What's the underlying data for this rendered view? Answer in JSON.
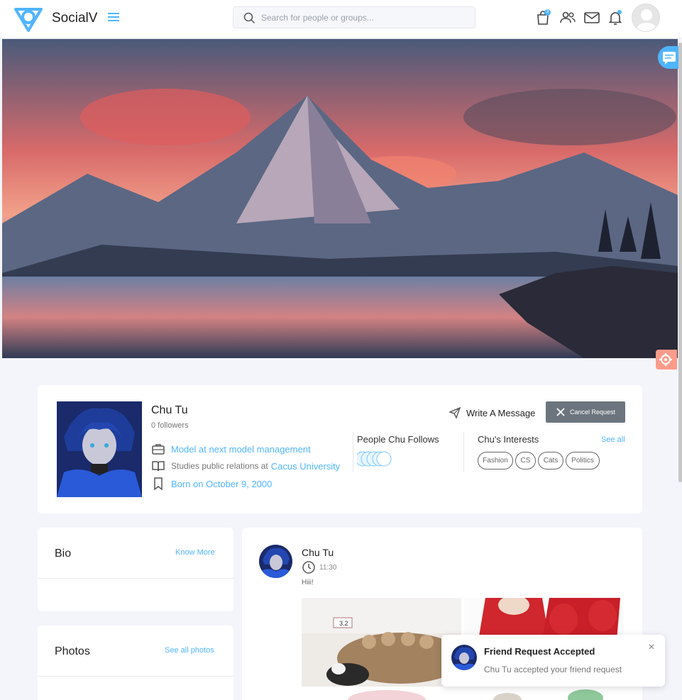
{
  "header": {
    "brand": "SocialV",
    "search_placeholder": "Search for people or groups...",
    "cart_badge": "3"
  },
  "profile": {
    "name": "Chu Tu",
    "followers": "0 followers",
    "job": "Model at next model management",
    "study_prefix": "Studies public relations at",
    "study_school": "Cacus University",
    "birthday": "Born on October 9, 2000",
    "write_message": "Write A Message",
    "cancel_request": "Cancel Request",
    "follows_title": "People Chu Follows",
    "interests_title": "Chu's Interests",
    "interests_see_all": "See all",
    "interests": [
      "Fashion",
      "CS",
      "Cats",
      "Politics"
    ]
  },
  "bio": {
    "title": "Bio",
    "link": "Know More"
  },
  "photos": {
    "title": "Photos",
    "link": "See all photos"
  },
  "post": {
    "author": "Chu Tu",
    "time": "11:30",
    "text": "Hiii!",
    "image1_label": "3.2"
  },
  "toast": {
    "title": "Friend Request Accepted",
    "message": "Chu Tu accepted your friend request",
    "close": "×"
  },
  "colors": {
    "accent": "#50b5ff",
    "cancel": "#6c757d",
    "settings": "#ff9b8a"
  }
}
